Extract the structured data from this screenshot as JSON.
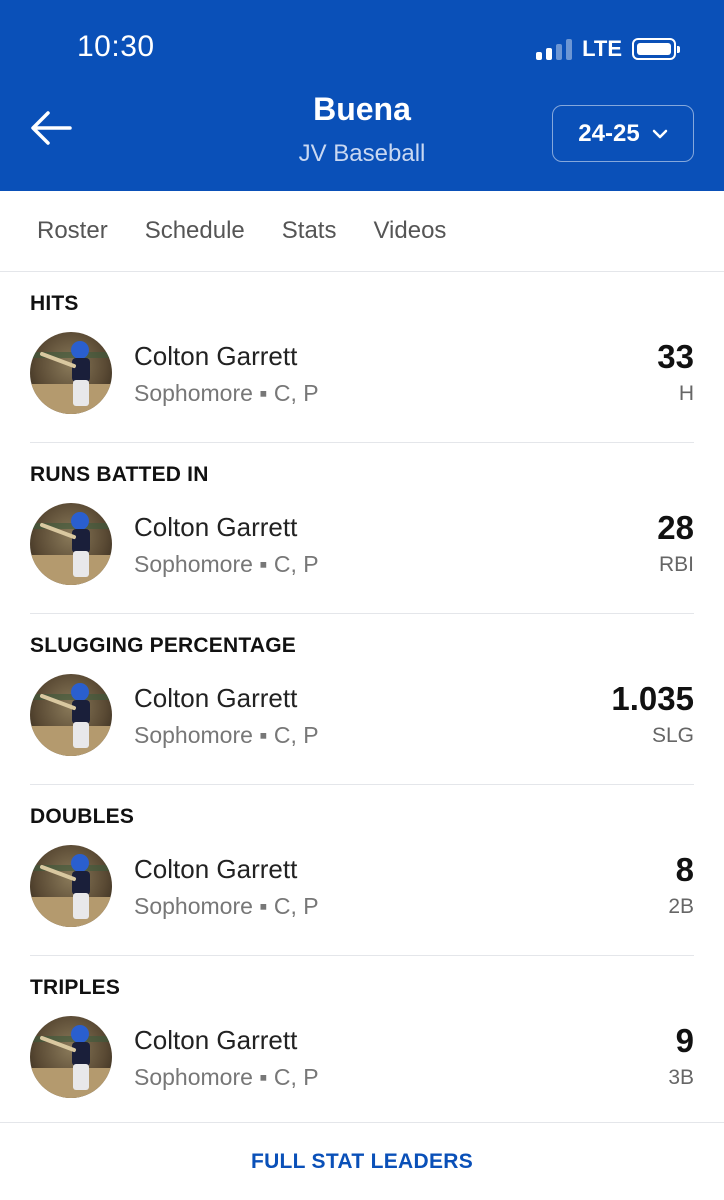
{
  "status_bar": {
    "time": "10:30",
    "network": "LTE"
  },
  "header": {
    "title": "Buena",
    "subtitle": "JV Baseball",
    "season": "24-25"
  },
  "tabs": [
    {
      "label": "Roster"
    },
    {
      "label": "Schedule"
    },
    {
      "label": "Stats"
    },
    {
      "label": "Videos"
    }
  ],
  "stats": [
    {
      "title": "HITS",
      "player": "Colton Garrett",
      "meta": "Sophomore ▪ C, P",
      "value": "33",
      "unit": "H"
    },
    {
      "title": "RUNS BATTED IN",
      "player": "Colton Garrett",
      "meta": "Sophomore ▪ C, P",
      "value": "28",
      "unit": "RBI"
    },
    {
      "title": "SLUGGING PERCENTAGE",
      "player": "Colton Garrett",
      "meta": "Sophomore ▪ C, P",
      "value": "1.035",
      "unit": "SLG"
    },
    {
      "title": "DOUBLES",
      "player": "Colton Garrett",
      "meta": "Sophomore ▪ C, P",
      "value": "8",
      "unit": "2B"
    },
    {
      "title": "TRIPLES",
      "player": "Colton Garrett",
      "meta": "Sophomore ▪ C, P",
      "value": "9",
      "unit": "3B"
    }
  ],
  "footer": {
    "link_label": "FULL STAT LEADERS"
  },
  "colors": {
    "brand": "#0a50b8",
    "header_bg": "#0a50b8"
  },
  "icons": {
    "back": "arrow-left-icon",
    "season_dropdown": "chevron-down-icon",
    "signal": "signal-icon",
    "battery": "battery-icon"
  }
}
